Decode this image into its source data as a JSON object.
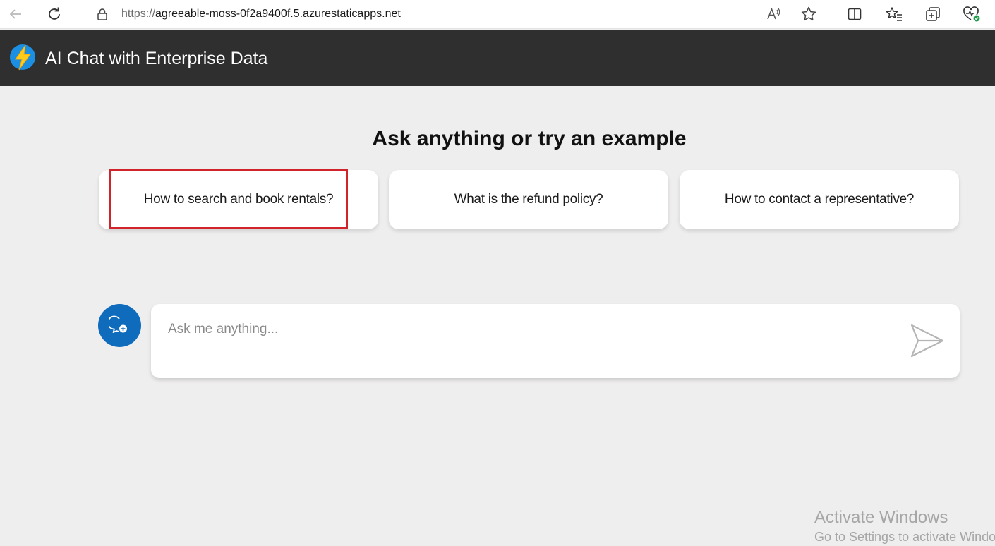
{
  "browser": {
    "url_scheme": "https://",
    "url_host": "agreeable-moss-0f2a9400f.5.azurestaticapps.net",
    "icons": [
      "back-icon",
      "refresh-icon",
      "lock-icon",
      "read-aloud-icon",
      "favorite-star-icon",
      "split-screen-icon",
      "favorites-icon",
      "collections-icon",
      "browser-essentials-icon"
    ]
  },
  "header": {
    "title": "AI Chat with Enterprise Data",
    "logo_icon": "lightning-icon"
  },
  "main": {
    "headline": "Ask anything or try an example",
    "examples": [
      "How to search and book rentals?",
      "What is the refund policy?",
      "How to contact a representative?"
    ]
  },
  "chat": {
    "placeholder": "Ask me anything...",
    "new_chat_icon": "new-chat-icon",
    "send_icon": "send-icon"
  },
  "watermark": {
    "title": "Activate Windows",
    "subtitle": "Go to Settings to activate Windows."
  },
  "colors": {
    "header_bg": "#2f2f2f",
    "page_bg": "#efeeee",
    "accent": "#0f6cbd",
    "highlight": "#d0232a"
  }
}
